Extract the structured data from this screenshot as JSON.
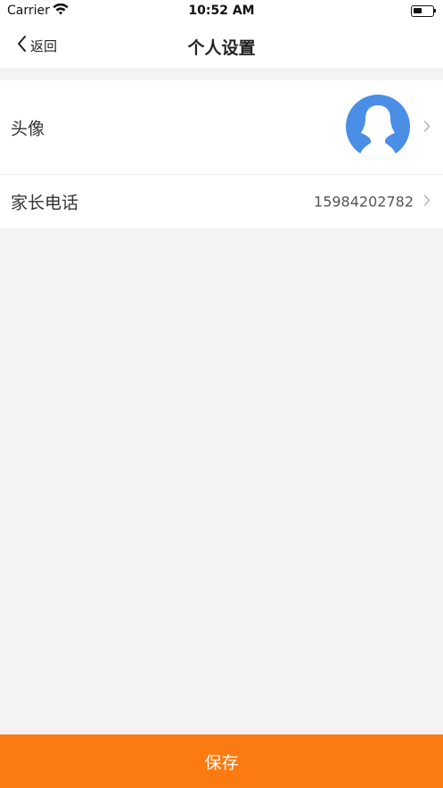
{
  "status_bar": {
    "carrier": "Carrier",
    "time": "10:52 AM",
    "icons": [
      "wifi-icon",
      "battery-icon"
    ]
  },
  "nav": {
    "back_label": "返回",
    "title": "个人设置",
    "back_icon": "chevron-left-icon"
  },
  "settings": {
    "rows": [
      {
        "label": "头像",
        "value": "",
        "icon": "avatar-placeholder-icon"
      },
      {
        "label": "家长电话",
        "value": "15984202782"
      }
    ]
  },
  "footer": {
    "save_label": "保存"
  },
  "colors": {
    "accent": "#fb7a12",
    "avatar_bg": "#4a8ee6",
    "background": "#f3f3f3"
  }
}
